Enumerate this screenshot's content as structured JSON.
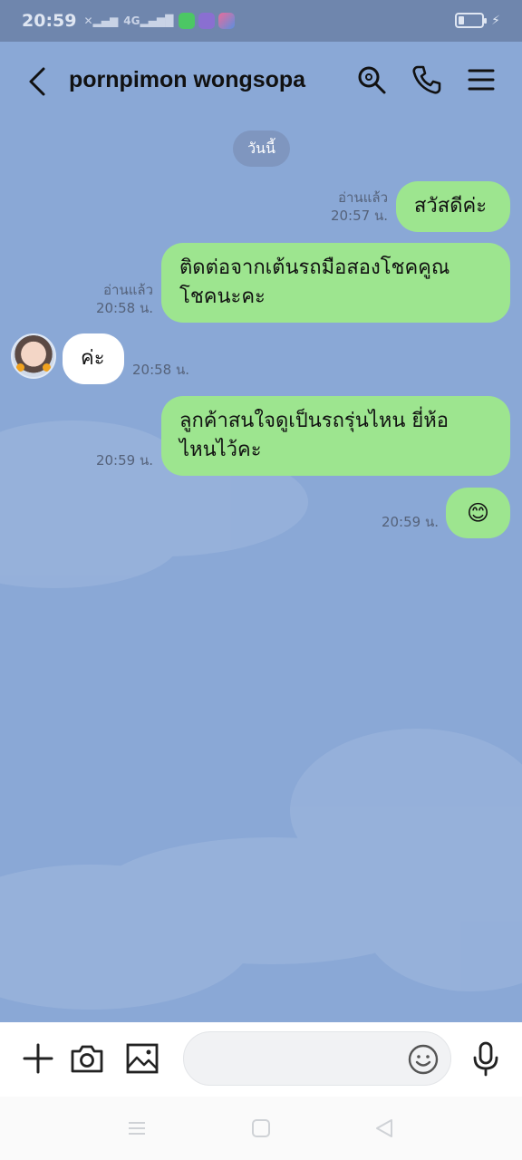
{
  "status_bar": {
    "time": "20:59",
    "network": "4G"
  },
  "header": {
    "title": "pornpimon wongsopa"
  },
  "chat": {
    "date_divider": "วันนี้",
    "messages": [
      {
        "direction": "sent",
        "text": "สวัสดีค่ะ",
        "read": "อ่านแล้ว",
        "time": "20:57 น."
      },
      {
        "direction": "sent",
        "lines": [
          "ติดต่อจากเต้นรถมือสองโชคคูณ",
          "โชคนะคะ"
        ],
        "read": "อ่านแล้ว",
        "time": "20:58 น."
      },
      {
        "direction": "received",
        "text": "ค่ะ",
        "time": "20:58 น."
      },
      {
        "direction": "sent",
        "lines": [
          "ลูกค้าสนใจดูเป็นรถรุ่นไหน ยี่ห้อ",
          "ไหนไว้คะ"
        ],
        "time": "20:59 น."
      },
      {
        "direction": "sent",
        "text": "😊",
        "time": "20:59 น."
      }
    ]
  },
  "input": {
    "placeholder": ""
  },
  "colors": {
    "chat_background": "#8aa8d6",
    "sent_bubble": "#9de58f",
    "received_bubble": "#ffffff",
    "status_bar": "#6f86ad"
  },
  "icons": {
    "header": [
      "back-arrow-icon",
      "search-icon",
      "phone-icon",
      "menu-icon"
    ],
    "input_bar": [
      "plus-icon",
      "camera-icon",
      "image-icon",
      "emoji-icon",
      "microphone-icon"
    ],
    "nav_bar": [
      "recent-apps-icon",
      "home-icon",
      "back-icon"
    ]
  }
}
